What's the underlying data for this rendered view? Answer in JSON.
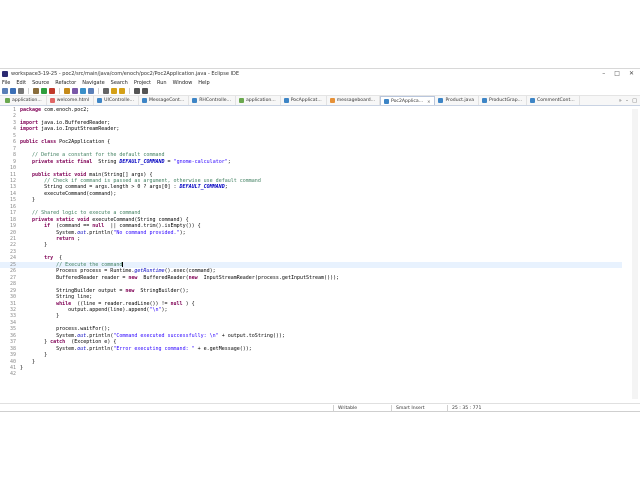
{
  "window": {
    "title": "workspace3-19-25 - poc2/src/main/java/com/enoch/poc2/Poc2Application.java - Eclipse IDE",
    "controls": [
      "–",
      "□",
      "✕"
    ]
  },
  "menu": [
    "File",
    "Edit",
    "Source",
    "Refactor",
    "Navigate",
    "Search",
    "Project",
    "Run",
    "Window",
    "Help"
  ],
  "toolbar": {
    "icons": [
      "new-icon",
      "save-icon",
      "print-icon",
      "debug-icon",
      "run-icon",
      "external-tools-icon",
      "new-java-project-icon",
      "new-package-icon",
      "new-class-icon",
      "open-type-icon",
      "search-icon",
      "prev-annotation-icon",
      "next-annotation-icon",
      "back-icon",
      "forward-icon"
    ],
    "colors": [
      "#5a7fb8",
      "#3b6fb6",
      "#777777",
      "#8a6d3b",
      "#2e9e3e",
      "#c0392b",
      "#c58a1a",
      "#7a58a8",
      "#3a8fc8",
      "#5a7fb8",
      "#666666",
      "#d4a017",
      "#d4a017",
      "#555555",
      "#555555"
    ]
  },
  "tabs": [
    {
      "label": "application...",
      "color": "#6aa84f"
    },
    {
      "label": "welcome.html",
      "color": "#e06666"
    },
    {
      "label": "UIControlle...",
      "color": "#3d85c6"
    },
    {
      "label": "MessageCont...",
      "color": "#3d85c6"
    },
    {
      "label": "RHControlle...",
      "color": "#3d85c6"
    },
    {
      "label": "application...",
      "color": "#6aa84f"
    },
    {
      "label": "PocApplicat...",
      "color": "#3d85c6"
    },
    {
      "label": "messageboard...",
      "color": "#e69138"
    },
    {
      "label": "Poc2Applica...",
      "color": "#3d85c6",
      "active": true
    },
    {
      "label": "Product.java",
      "color": "#3d85c6"
    },
    {
      "label": "ProductGrap...",
      "color": "#3d85c6"
    },
    {
      "label": "CommentCont...",
      "color": "#3d85c6"
    }
  ],
  "tab_controls": [
    "»",
    "–",
    "□"
  ],
  "editor": {
    "current_line": 25,
    "lines": [
      {
        "n": "1",
        "t": [
          [
            "kw",
            "package"
          ],
          [
            "",
            "com.enoch.poc2;"
          ]
        ]
      },
      {
        "n": "2",
        "t": []
      },
      {
        "n": "3",
        "t": [
          [
            "kw",
            "import"
          ],
          [
            "",
            "java.io.BufferedReader;"
          ]
        ]
      },
      {
        "n": "4",
        "t": [
          [
            "kw",
            "import"
          ],
          [
            "",
            "java.io.InputStreamReader;"
          ]
        ]
      },
      {
        "n": "5",
        "t": []
      },
      {
        "n": "6",
        "t": [
          [
            "kw",
            "public class"
          ],
          [
            "",
            "Poc2Application {"
          ]
        ]
      },
      {
        "n": "7",
        "t": []
      },
      {
        "n": "8",
        "t": [
          [
            "",
            "    "
          ],
          [
            "cm",
            "// Define a constant for the default command"
          ]
        ]
      },
      {
        "n": "9",
        "t": [
          [
            "",
            "    "
          ],
          [
            "kw",
            "private static final"
          ],
          [
            "",
            " String "
          ],
          [
            "fd",
            "DEFAULT_COMMAND"
          ],
          [
            "",
            " = "
          ],
          [
            "st",
            "\"gnome-calculator\""
          ],
          [
            "",
            ";"
          ]
        ]
      },
      {
        "n": "10",
        "t": []
      },
      {
        "n": "11",
        "t": [
          [
            "",
            "    "
          ],
          [
            "kw",
            "public static void"
          ],
          [
            "",
            "main(String[] args) {"
          ]
        ]
      },
      {
        "n": "12",
        "t": [
          [
            "",
            "        "
          ],
          [
            "cm",
            "// Check if command is passed as argument, otherwise use default command"
          ]
        ]
      },
      {
        "n": "13",
        "t": [
          [
            "",
            "        String command = args.length > 0 ? args[0] : "
          ],
          [
            "fd",
            "DEFAULT_COMMAND"
          ],
          [
            "",
            ";"
          ]
        ]
      },
      {
        "n": "14",
        "t": [
          [
            "",
            "        executeCommand(command);"
          ]
        ]
      },
      {
        "n": "15",
        "t": [
          [
            "",
            "    }"
          ]
        ]
      },
      {
        "n": "16",
        "t": []
      },
      {
        "n": "17",
        "t": [
          [
            "",
            "    "
          ],
          [
            "cm",
            "// Shared logic to execute a command"
          ]
        ]
      },
      {
        "n": "18",
        "t": [
          [
            "",
            "    "
          ],
          [
            "kw",
            "private static void"
          ],
          [
            "",
            "executeCommand(String command) {"
          ]
        ]
      },
      {
        "n": "19",
        "t": [
          [
            "",
            "        "
          ],
          [
            "kw",
            "if"
          ],
          [
            "",
            " (command == "
          ],
          [
            "kw",
            "null"
          ],
          [
            "",
            " || command.trim().isEmpty()) {"
          ]
        ]
      },
      {
        "n": "20",
        "t": [
          [
            "",
            "            System."
          ],
          [
            "fd2",
            "out"
          ],
          [
            "",
            ".println("
          ],
          [
            "st",
            "\"No command provided.\""
          ],
          [
            "",
            ");"
          ]
        ]
      },
      {
        "n": "21",
        "t": [
          [
            "",
            "            "
          ],
          [
            "kw",
            "return"
          ],
          [
            "",
            ";"
          ]
        ]
      },
      {
        "n": "22",
        "t": [
          [
            "",
            "        }"
          ]
        ]
      },
      {
        "n": "23",
        "t": []
      },
      {
        "n": "24",
        "t": [
          [
            "",
            "        "
          ],
          [
            "kw",
            "try"
          ],
          [
            "",
            " {"
          ]
        ]
      },
      {
        "n": "25",
        "t": [
          [
            "",
            "            "
          ],
          [
            "cm",
            "// Execute the command"
          ],
          [
            "caret",
            ""
          ]
        ]
      },
      {
        "n": "26",
        "t": [
          [
            "",
            "            Process process = Runtime."
          ],
          [
            "fd2",
            "getRuntime"
          ],
          [
            "",
            "().exec(command);"
          ]
        ]
      },
      {
        "n": "27",
        "t": [
          [
            "",
            "            BufferedReader reader = "
          ],
          [
            "kw",
            "new"
          ],
          [
            "",
            " BufferedReader("
          ],
          [
            "kw",
            "new"
          ],
          [
            "",
            " InputStreamReader(process.getInputStream()));"
          ]
        ]
      },
      {
        "n": "28",
        "t": []
      },
      {
        "n": "29",
        "t": [
          [
            "",
            "            StringBuilder output = "
          ],
          [
            "kw",
            "new"
          ],
          [
            "",
            " StringBuilder();"
          ]
        ]
      },
      {
        "n": "30",
        "t": [
          [
            "",
            "            String line;"
          ]
        ]
      },
      {
        "n": "31",
        "t": [
          [
            "",
            "            "
          ],
          [
            "kw",
            "while"
          ],
          [
            "",
            " ((line = reader.readLine()) != "
          ],
          [
            "kw",
            "null"
          ],
          [
            "",
            ") {"
          ]
        ]
      },
      {
        "n": "32",
        "t": [
          [
            "",
            "                output.append(line).append("
          ],
          [
            "st",
            "\"\\n\""
          ],
          [
            "",
            ");"
          ]
        ]
      },
      {
        "n": "33",
        "t": [
          [
            "",
            "            }"
          ]
        ]
      },
      {
        "n": "34",
        "t": []
      },
      {
        "n": "35",
        "t": [
          [
            "",
            "            process.waitFor();"
          ]
        ]
      },
      {
        "n": "36",
        "t": [
          [
            "",
            "            System."
          ],
          [
            "fd2",
            "out"
          ],
          [
            "",
            ".println("
          ],
          [
            "st",
            "\"Command executed successfully: \\n\""
          ],
          [
            "",
            " + output.toString());"
          ]
        ]
      },
      {
        "n": "37",
        "t": [
          [
            "",
            "        } "
          ],
          [
            "kw",
            "catch"
          ],
          [
            "",
            " (Exception e) {"
          ]
        ]
      },
      {
        "n": "38",
        "t": [
          [
            "",
            "            System."
          ],
          [
            "fd2",
            "out"
          ],
          [
            "",
            ".println("
          ],
          [
            "st",
            "\"Error executing command: \""
          ],
          [
            "",
            " + e.getMessage());"
          ]
        ]
      },
      {
        "n": "39",
        "t": [
          [
            "",
            "        }"
          ]
        ]
      },
      {
        "n": "40",
        "t": [
          [
            "",
            "    }"
          ]
        ]
      },
      {
        "n": "41",
        "t": [
          [
            "",
            "}"
          ]
        ]
      },
      {
        "n": "42",
        "t": []
      }
    ]
  },
  "status": {
    "mode": "Writable",
    "insert": "Smart Insert",
    "position": "25 : 35 : 771"
  }
}
